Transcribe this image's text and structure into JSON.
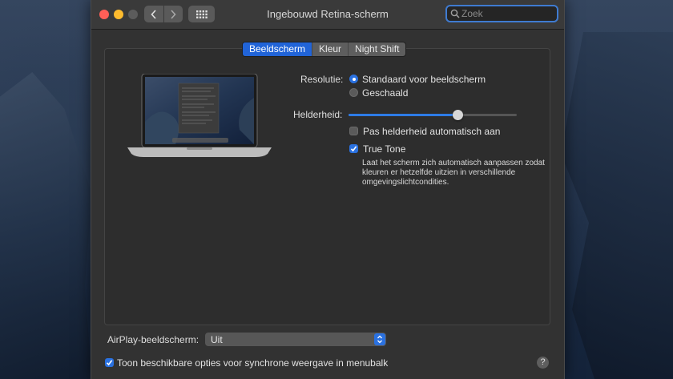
{
  "window": {
    "title": "Ingebouwd Retina-scherm",
    "search_placeholder": "Zoek"
  },
  "tabs": [
    {
      "label": "Beeldscherm",
      "active": true
    },
    {
      "label": "Kleur",
      "active": false
    },
    {
      "label": "Night Shift",
      "active": false
    }
  ],
  "resolution": {
    "label": "Resolutie:",
    "options": [
      {
        "label": "Standaard voor beeldscherm",
        "selected": true
      },
      {
        "label": "Geschaald",
        "selected": false
      }
    ]
  },
  "brightness": {
    "label": "Helderheid:",
    "level": 0.65,
    "auto_label": "Pas helderheid automatisch aan",
    "auto_checked": false
  },
  "true_tone": {
    "label": "True Tone",
    "checked": true,
    "description": "Laat het scherm zich automatisch aanpassen zodat kleuren er hetzelfde uitzien in verschillende omgevingslichtcondities."
  },
  "airplay": {
    "label": "AirPlay-beeldscherm:",
    "value": "Uit"
  },
  "menubar_option": {
    "label": "Toon beschikbare opties voor synchrone weergave in menubalk",
    "checked": true
  },
  "help": "?",
  "colors": {
    "accent": "#2a71e0",
    "window_bg": "#323232"
  }
}
